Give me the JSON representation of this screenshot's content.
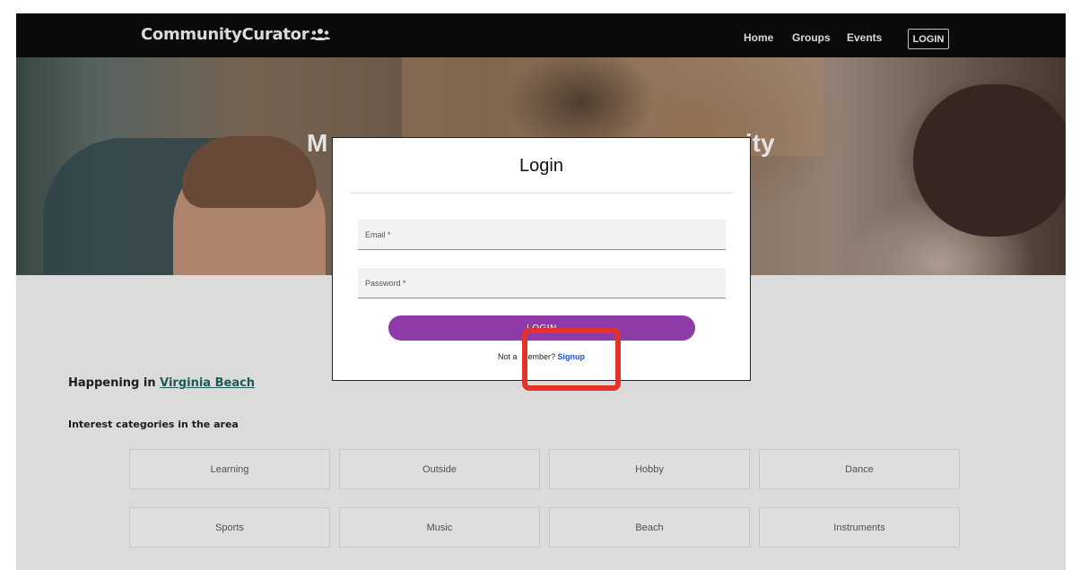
{
  "nav": {
    "brand": "CommunityCurator",
    "links": [
      "Home",
      "Groups",
      "Events"
    ],
    "login": "LOGIN"
  },
  "hero": {
    "title_visible_left": "M",
    "title_visible_right": "ity"
  },
  "content": {
    "happening_prefix": "Happening in",
    "city": "Virginia Beach",
    "interest_title": "Interest categories in the area",
    "categories": [
      "Learning",
      "Outside",
      "Hobby",
      "Dance",
      "Sports",
      "Music",
      "Beach",
      "Instruments"
    ]
  },
  "modal": {
    "title": "Login",
    "email_label": "Email *",
    "password_label": "Password *",
    "login_button": "LOGIN",
    "signup_prompt_visible": "Not a",
    "signup_prompt_rest": "ember?",
    "signup_link": "Signup"
  },
  "colors": {
    "navbar": "#0b0b0b",
    "accent_button": "#8e3aa8",
    "link": "#1a57c4",
    "highlight": "#e4322b"
  }
}
